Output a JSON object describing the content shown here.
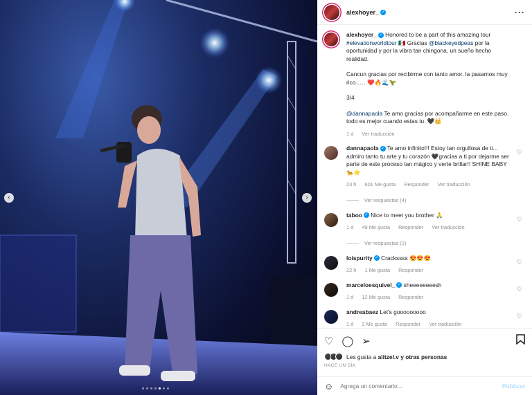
{
  "post": {
    "username": "alexhoyer_",
    "caption_user": "alexhoyer_",
    "caption_text": "Honored to be a part of this amazing tour",
    "caption_tag": "#elevationworldtour",
    "caption_mid": "🇲🇽 Gracias",
    "caption_mention": "@blackeyedpeas",
    "caption_rest": "por la oportunidad y por la vibra tan chingona, un sueño hecho realidad.",
    "caption_para2": "Cancun gracias por recibirme con tanto amor. la pasamos muy rico……❤️🔥🌊🦖",
    "caption_para3": "3/4",
    "caption_mention2": "@dannapaola",
    "caption_para4": "Te amo gracias por acompañarme en este paso. todo es mejor cuando estas tu. 🖤👑",
    "caption_time": "1 d",
    "caption_translate": "Ver traducción"
  },
  "comments": [
    {
      "user": "dannapaola",
      "text": "Te amo infinito!!! Estoy tan orgullosa de ti... admiro tanto tu arte y tu corazón 🖤gracias a ti por dejarme ser parte de este proceso tan mágico y verte brillar!! SHINE BABY🐆⭐",
      "time": "23 h",
      "likes": "601 Me gusta",
      "reply": "Responder",
      "translate": "Ver traducción",
      "replies": "Ver respuestas (4)"
    },
    {
      "user": "taboo",
      "text": "Nice to meet you brother 🙏",
      "time": "1 d",
      "likes": "49 Me gusta",
      "reply": "Responder",
      "translate": "Ver traducción",
      "replies": "Ver respuestas (1)"
    },
    {
      "user": "loispurity",
      "text": "Crackssss 😍😍😍",
      "time": "22 h",
      "likes": "1 Me gusta",
      "reply": "Responder"
    },
    {
      "user": "marceloesquivel_",
      "text": "sheeeeeeeesh",
      "time": "1 d",
      "likes": "12 Me gusta",
      "reply": "Responder"
    },
    {
      "user": "andreabaez",
      "text": "Let's gooooooooo",
      "time": "1 d",
      "likes": "2 Me gusta",
      "reply": "Responder",
      "translate": "Ver traducción"
    }
  ],
  "likes": {
    "prefix": "Les gusta a",
    "user": "alitzel.v",
    "suffix": "y otras personas"
  },
  "time_ago": "HACE UN DÍA",
  "comment_box": {
    "placeholder": "Agrega un comentario...",
    "publish": "Publicar"
  },
  "icons": {
    "more": "more-options-icon",
    "heart": "heart-icon",
    "comment": "comment-icon",
    "share": "share-icon",
    "save": "bookmark-icon",
    "emoji": "emoji-icon"
  }
}
